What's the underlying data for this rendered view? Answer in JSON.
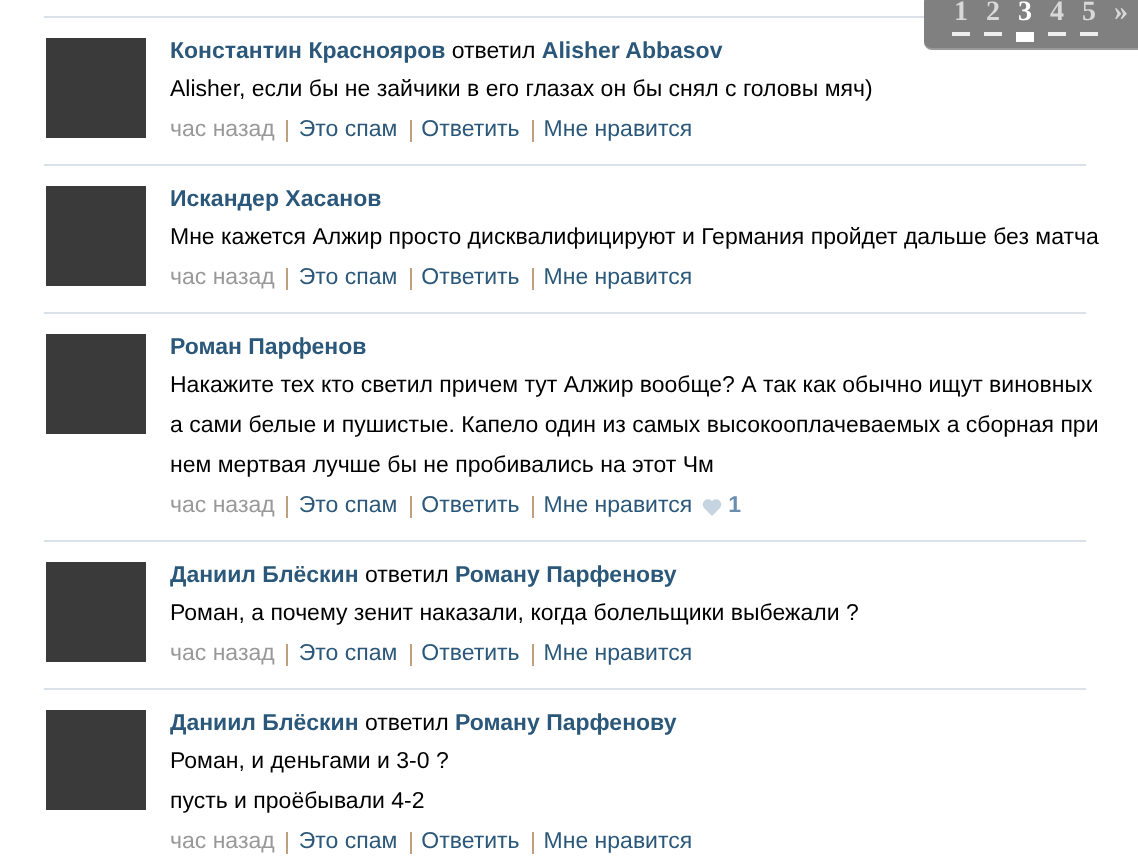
{
  "pagination": {
    "pages": [
      {
        "label": "1",
        "selected": false
      },
      {
        "label": "2",
        "selected": false
      },
      {
        "label": "3",
        "selected": true
      },
      {
        "label": "4",
        "selected": false
      },
      {
        "label": "5",
        "selected": false
      }
    ],
    "next": "»"
  },
  "comments": [
    {
      "author": "Константин Краснояров",
      "reply_word": "ответил",
      "reply_to": "Alisher Abbasov",
      "lines": [
        "Alisher, если бы не зайчики в его глазах он бы снял с головы мяч)"
      ],
      "time": "час назад",
      "actions": [
        "Это спам",
        "Ответить",
        "Мне нравится"
      ]
    },
    {
      "author": "Искандер Хасанов",
      "lines": [
        "Мне кажется Алжир просто дисквалифицируют и Германия пройдет дальше без матча"
      ],
      "time": "час назад",
      "actions": [
        "Это спам",
        "Ответить",
        "Мне нравится"
      ]
    },
    {
      "author": "Роман Парфенов",
      "lines": [
        "Накажите тех кто светил причем тут Алжир вообще? А так как обычно ищут виновных",
        "а сами белые и пушистые. Капело один из самых высокооплачеваемых а сборная при",
        "нем мертвая лучше бы не пробивались на этот Чм"
      ],
      "time": "час назад",
      "actions": [
        "Это спам",
        "Ответить",
        "Мне нравится"
      ],
      "likes": "1"
    },
    {
      "author": "Даниил Блёскин",
      "reply_word": "ответил",
      "reply_to": "Роману Парфенову",
      "lines": [
        "Роман, а почему зенит наказали, когда болельщики выбежали ?"
      ],
      "time": "час назад",
      "actions": [
        "Это спам",
        "Ответить",
        "Мне нравится"
      ]
    },
    {
      "author": "Даниил Блёскин",
      "reply_word": "ответил",
      "reply_to": "Роману Парфенову",
      "lines": [
        "Роман, и деньгами и 3-0 ?",
        "пусть и проёбывали 4-2"
      ],
      "time": "час назад",
      "actions": [
        "Это спам",
        "Ответить",
        "Мне нравится"
      ]
    }
  ]
}
